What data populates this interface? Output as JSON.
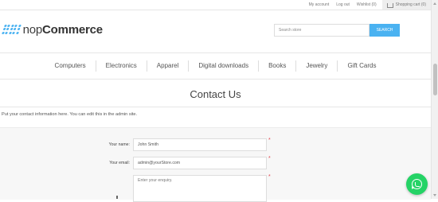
{
  "header": {
    "links": [
      "My account",
      "Log out",
      "Wishlist (0)"
    ],
    "cart": "Shopping cart (0)"
  },
  "logo": {
    "prefix": "nop",
    "brand": "Commerce"
  },
  "search": {
    "placeholder": "Search store",
    "button": "SEARCH"
  },
  "menu": [
    "Computers",
    "Electronics",
    "Apparel",
    "Digital downloads",
    "Books",
    "Jewelry",
    "Gift Cards"
  ],
  "page": {
    "title": "Contact Us",
    "intro": "Put your contact information here. You can edit this in the admin site."
  },
  "form": {
    "name_label": "Your name:",
    "name_value": "John Smith",
    "email_label": "Your email:",
    "email_value": "admin@yourStore.com",
    "enquiry_placeholder": "Enter your enquiry.",
    "required_mark": "*"
  },
  "colors": {
    "accent": "#4ab2f1",
    "required": "#e4444c",
    "whatsapp": "#25d366"
  },
  "icons": {
    "cart": "shopping-cart-icon",
    "chat": "whatsapp-icon"
  }
}
